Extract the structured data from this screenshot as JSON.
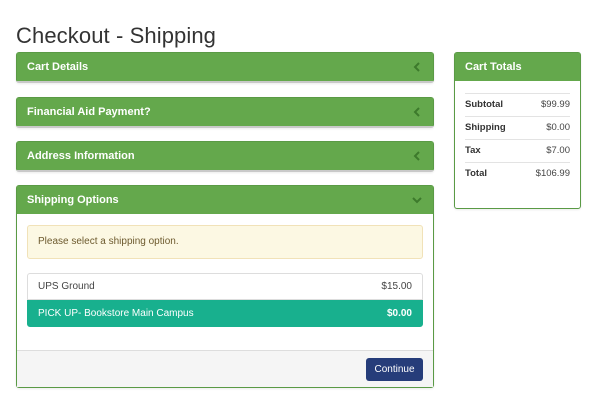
{
  "page": {
    "title": "Checkout - Shipping"
  },
  "sections": {
    "cart_details": "Cart Details",
    "financial_aid": "Financial Aid Payment?",
    "address_info": "Address Information",
    "shipping_options": "Shipping Options"
  },
  "shipping": {
    "notice": "Please select a shipping option.",
    "options": [
      {
        "label": "UPS Ground",
        "price": "$15.00",
        "selected": false
      },
      {
        "label": "PICK UP- Bookstore Main Campus",
        "price": "$0.00",
        "selected": true
      }
    ],
    "continue_label": "Continue"
  },
  "cart_totals": {
    "title": "Cart Totals",
    "rows": [
      {
        "label": "Subtotal",
        "value": "$99.99"
      },
      {
        "label": "Shipping",
        "value": "$0.00"
      },
      {
        "label": "Tax",
        "value": "$7.00"
      },
      {
        "label": "Total",
        "value": "$106.99"
      }
    ]
  },
  "colors": {
    "panel_header": "#64a84c",
    "selected_option": "#18b08e",
    "continue_button": "#263d7a",
    "notice_bg": "#fcf8e3"
  },
  "icons": {
    "collapsed": "chevron-left-icon",
    "expanded": "chevron-down-icon"
  }
}
